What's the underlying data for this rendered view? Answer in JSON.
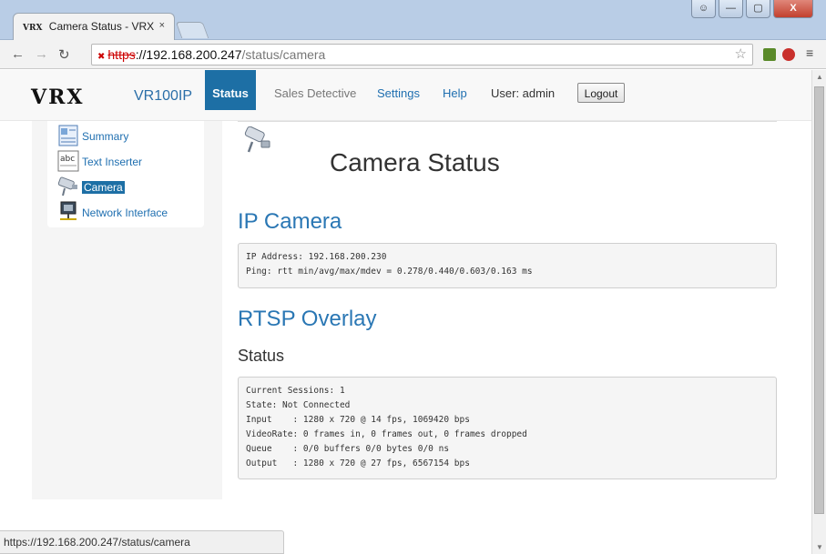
{
  "browser": {
    "tab_title": "Camera Status - VRX",
    "tab_favicon_text": "VRX",
    "tab_close": "×",
    "url_scheme": "https",
    "url_host": "://192.168.200.247",
    "url_path": "/status/camera",
    "status_url": "https://192.168.200.247/status/camera",
    "window_buttons": [
      "—",
      "▢",
      "X"
    ]
  },
  "header": {
    "brand": "VRX",
    "model": "VR100IP",
    "menu": [
      "Status",
      "Sales Detective",
      "Settings",
      "Help"
    ],
    "user_label": "User: admin",
    "logout_label": "Logout"
  },
  "sidebar": {
    "items": [
      {
        "label": "Summary",
        "icon": "summary-icon"
      },
      {
        "label": "Text Inserter",
        "icon": "text-inserter-icon"
      },
      {
        "label": "Camera",
        "icon": "camera-icon"
      },
      {
        "label": "Network Interface",
        "icon": "network-icon"
      }
    ],
    "active_index": 2
  },
  "main": {
    "page_title": "Camera Status",
    "ip_camera_heading": "IP Camera",
    "ip_camera_text": "IP Address: 192.168.200.230\nPing: rtt min/avg/max/mdev = 0.278/0.440/0.603/0.163 ms",
    "rtsp_heading": "RTSP Overlay",
    "status_heading": "Status",
    "rtsp_status_text": "Current Sessions: 1\nState: Not Connected\nInput    : 1280 x 720 @ 14 fps, 1069420 bps\nVideoRate: 0 frames in, 0 frames out, 0 frames dropped\nQueue    : 0/0 buffers 0/0 bytes 0/0 ns\nOutput   : 1280 x 720 @ 27 fps, 6567154 bps"
  },
  "colors": {
    "accent": "#1d6fa5",
    "heading_blue": "#2a77b4",
    "titlebar": "#b9cde6"
  }
}
